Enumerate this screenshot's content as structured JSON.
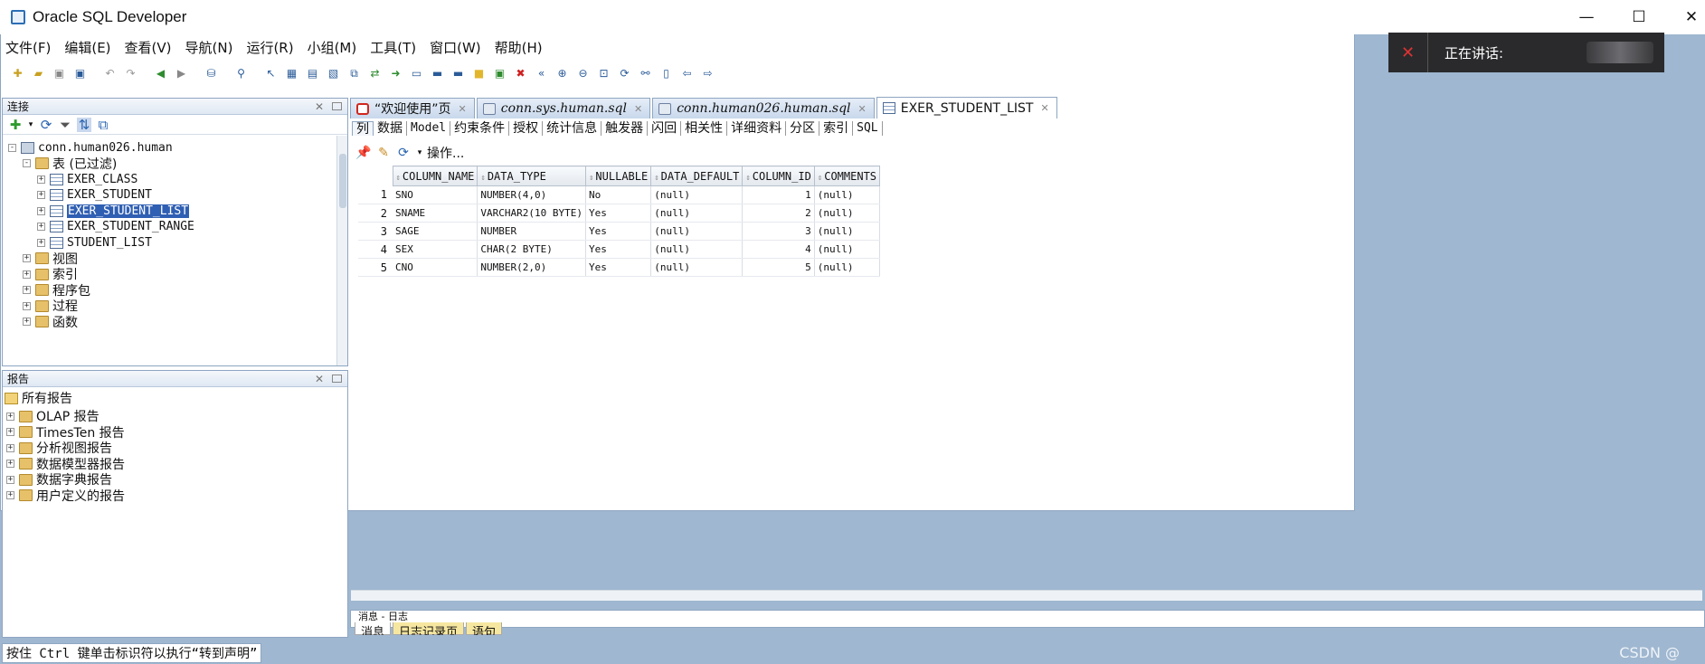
{
  "window": {
    "title": "Oracle SQL Developer",
    "controls": [
      "minimize-icon",
      "maximize-icon",
      "close-icon"
    ]
  },
  "menu": [
    "文件(F)",
    "编辑(E)",
    "查看(V)",
    "导航(N)",
    "运行(R)",
    "小组(M)",
    "工具(T)",
    "窗口(W)",
    "帮助(H)"
  ],
  "toast": {
    "text": "正在讲话:"
  },
  "connections": {
    "title": "连接",
    "tree": [
      {
        "label": "conn.human026.human",
        "level": 0,
        "icon": "db",
        "expander": "-"
      },
      {
        "label": "表 (已过滤)",
        "level": 1,
        "icon": "folder",
        "expander": "-"
      },
      {
        "label": "EXER_CLASS",
        "level": 2,
        "icon": "table",
        "expander": "+"
      },
      {
        "label": "EXER_STUDENT",
        "level": 2,
        "icon": "table",
        "expander": "+"
      },
      {
        "label": "EXER_STUDENT_LIST",
        "level": 2,
        "icon": "table",
        "expander": "+",
        "selected": true
      },
      {
        "label": "EXER_STUDENT_RANGE",
        "level": 2,
        "icon": "table",
        "expander": "+"
      },
      {
        "label": "STUDENT_LIST",
        "level": 2,
        "icon": "table",
        "expander": "+"
      },
      {
        "label": "视图",
        "level": 1,
        "icon": "folder",
        "expander": "+"
      },
      {
        "label": "索引",
        "level": 1,
        "icon": "folder",
        "expander": "+"
      },
      {
        "label": "程序包",
        "level": 1,
        "icon": "folder",
        "expander": "+"
      },
      {
        "label": "过程",
        "level": 1,
        "icon": "folder",
        "expander": "+"
      },
      {
        "label": "函数",
        "level": 1,
        "icon": "folder",
        "expander": "+"
      }
    ]
  },
  "reports": {
    "title": "报告",
    "root": "所有报告",
    "items": [
      "OLAP 报告",
      "TimesTen 报告",
      "分析视图报告",
      "数据模型器报告",
      "数据字典报告",
      "用户定义的报告"
    ]
  },
  "editor": {
    "tabs": [
      {
        "label": "“欢迎使用”页",
        "icon": "oracle-icon"
      },
      {
        "label": "conn.sys.human.sql",
        "icon": "sql-worksheet-icon"
      },
      {
        "label": "conn.human026.human.sql",
        "icon": "sql-worksheet-icon"
      },
      {
        "label": "EXER_STUDENT_LIST",
        "icon": "table-icon",
        "active": true
      }
    ],
    "subtabs": [
      "列",
      "数据",
      "Model",
      "约束条件",
      "授权",
      "统计信息",
      "触发器",
      "闪回",
      "相关性",
      "详细资料",
      "分区",
      "索引",
      "SQL"
    ],
    "actions_label": "操作...",
    "grid": {
      "columns": [
        "COLUMN_NAME",
        "DATA_TYPE",
        "NULLABLE",
        "DATA_DEFAULT",
        "COLUMN_ID",
        "COMMENTS"
      ],
      "rows": [
        [
          "1",
          "SNO",
          "NUMBER(4,0)",
          "No",
          "(null)",
          "1",
          "(null)"
        ],
        [
          "2",
          "SNAME",
          "VARCHAR2(10 BYTE)",
          "Yes",
          "(null)",
          "2",
          "(null)"
        ],
        [
          "3",
          "SAGE",
          "NUMBER",
          "Yes",
          "(null)",
          "3",
          "(null)"
        ],
        [
          "4",
          "SEX",
          "CHAR(2 BYTE)",
          "Yes",
          "(null)",
          "4",
          "(null)"
        ],
        [
          "5",
          "CNO",
          "NUMBER(2,0)",
          "Yes",
          "(null)",
          "5",
          "(null)"
        ]
      ]
    }
  },
  "messages": {
    "title": "消息 - 日志",
    "tabs": [
      "消息",
      "日志记录页",
      "语句"
    ]
  },
  "status": {
    "text": "按住 Ctrl 键单击标识符以执行“转到声明”",
    "watermark": "CSDN @"
  }
}
